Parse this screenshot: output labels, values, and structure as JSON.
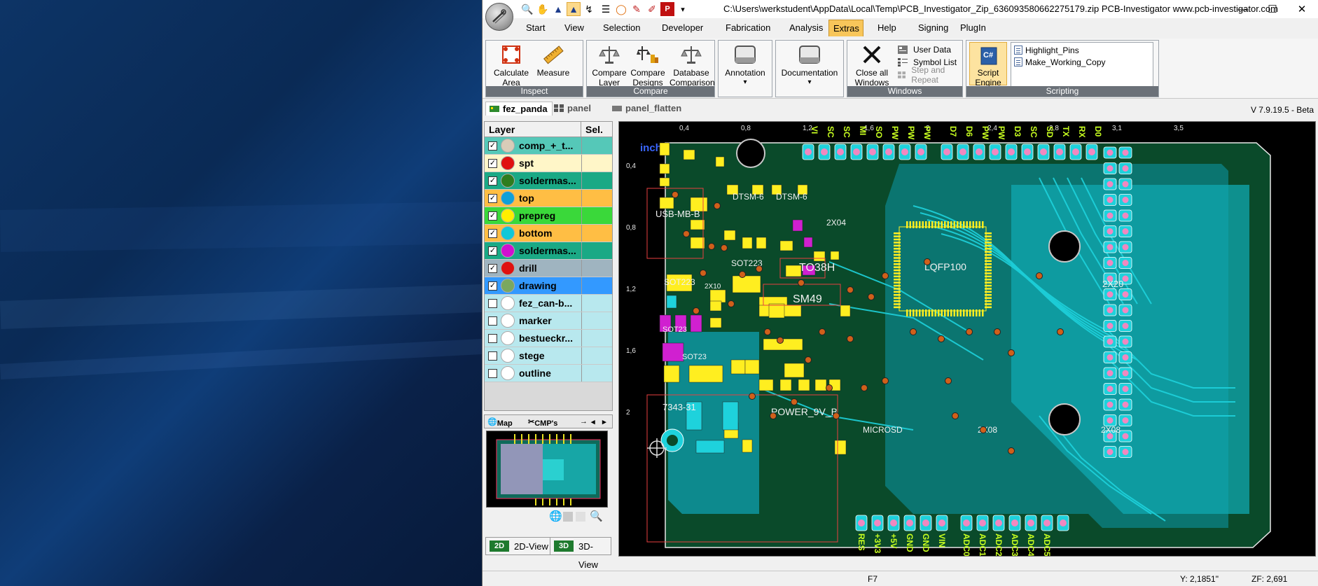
{
  "window": {
    "title": "C:\\Users\\werkstudent\\AppData\\Local\\Temp\\PCB_Investigator_Zip_636093580662275179.zip   PCB-Investigator   www.pcb-investigator.com",
    "minimize": "—",
    "maximize": "☐",
    "close": "✕"
  },
  "menu_tabs": [
    "Start",
    "View",
    "Selection",
    "Developer",
    "Fabrication",
    "Analysis",
    "Extras",
    "Help",
    "Signing",
    "PlugIn"
  ],
  "active_menu_tab": "Extras",
  "ribbon": {
    "inspect": {
      "label": "Inspect",
      "calculate_area": "Calculate Area",
      "measure": "Measure"
    },
    "compare": {
      "label": "Compare",
      "compare_layer": "Compare Layer",
      "compare_designs": "Compare Designs",
      "database_comparison": "Database Comparison"
    },
    "annotation": {
      "label": "Annotation"
    },
    "documentation": {
      "label": "Documentation"
    },
    "windows": {
      "label": "Windows",
      "close_all": "Close all Windows",
      "user_data": "User Data",
      "symbol_list": "Symbol List",
      "step_and_repeat": "Step and Repeat"
    },
    "scripting": {
      "label": "Scripting",
      "script_engine": "Script Engine",
      "scripts": [
        "Highlight_Pins",
        "Make_Working_Copy"
      ]
    }
  },
  "doc_tabs": [
    "fez_panda",
    "panel",
    "panel_flatten"
  ],
  "active_doc_tab": "fez_panda",
  "version": "V 7.9.19.5 - Beta",
  "layer_panel": {
    "header_layer": "Layer",
    "header_sel": "Sel.",
    "layers": [
      {
        "name": "comp_+_t...",
        "checked": true,
        "dot": "#d8ccb8",
        "bg": "#55c8b8"
      },
      {
        "name": "spt",
        "checked": true,
        "dot": "#e01010",
        "bg": "#fff6c8"
      },
      {
        "name": "soldermas...",
        "checked": true,
        "dot": "#2e7d1e",
        "bg": "#1aa985"
      },
      {
        "name": "top",
        "checked": true,
        "dot": "#10a0d8",
        "bg": "#ffbe44"
      },
      {
        "name": "prepreg",
        "checked": true,
        "dot": "#ffee00",
        "bg": "#3ad83a"
      },
      {
        "name": "bottom",
        "checked": true,
        "dot": "#10c8d8",
        "bg": "#ffbe44"
      },
      {
        "name": "soldermas...",
        "checked": true,
        "dot": "#d010d0",
        "bg": "#1aa985"
      },
      {
        "name": "drill",
        "checked": true,
        "dot": "#e01010",
        "bg": "#9fb4c0"
      },
      {
        "name": "drawing",
        "checked": true,
        "dot": "#7aa860",
        "bg": "#3399ff"
      },
      {
        "name": "fez_can-b...",
        "checked": false,
        "dot": "#ffffff",
        "bg": "#b8e8ee"
      },
      {
        "name": "marker",
        "checked": false,
        "dot": "#ffffff",
        "bg": "#b8e8ee"
      },
      {
        "name": "bestueckr...",
        "checked": false,
        "dot": "#ffffff",
        "bg": "#b8e8ee"
      },
      {
        "name": "stege",
        "checked": false,
        "dot": "#ffffff",
        "bg": "#b8e8ee"
      },
      {
        "name": "outline",
        "checked": false,
        "dot": "#ffffff",
        "bg": "#b8e8ee"
      }
    ]
  },
  "map_tabs": {
    "map": "Map",
    "cmps": "CMP's"
  },
  "view_buttons": {
    "view2d": "2D-View",
    "view3d": "3D-View",
    "icon2d": "2D",
    "icon3d": "3D"
  },
  "pcb": {
    "unit": "inch",
    "x_ticks": [
      "0,4",
      "0,8",
      "1,2",
      "1,6",
      "2",
      "2,4",
      "2,8",
      "3,1",
      "3,5"
    ],
    "y_ticks": [
      "0,4",
      "0,8",
      "1,2",
      "1,6",
      "2"
    ],
    "labels": [
      "DTSM-6",
      "DTSM-6",
      "USB-MB-B",
      "2X04",
      "SOT223",
      "TO38H",
      "SOT223",
      "SM49",
      "LQFP100",
      "2X20",
      "SOT23",
      "SOT23",
      "7343-31",
      "POWER_9V_B",
      "MICROSD",
      "2X08",
      "2X08",
      "2X10"
    ],
    "top_pin_labels": [
      "VI",
      "SC",
      "SC",
      "MI",
      "SO",
      "PW",
      "PW",
      "PW",
      "D7",
      "D6",
      "PW",
      "PW",
      "D3",
      "SC",
      "SD",
      "TX",
      "RX",
      "D0"
    ],
    "bottom_pin_labels": [
      "RES",
      "+3V3",
      "+5V",
      "GND",
      "GND",
      "VIN",
      "ADC0",
      "ADC1",
      "ADC2",
      "ADC3",
      "ADC4",
      "ADC5"
    ]
  },
  "status": {
    "key": "F7",
    "y": "Y: 2,1851\"",
    "zoom": "ZF: 2,691"
  },
  "colors": {
    "accent": "#f8c65a",
    "board": "#0b4a28",
    "copper": "#00c8d0",
    "pad": "#ffee20",
    "silk": "#e0e0e0"
  }
}
